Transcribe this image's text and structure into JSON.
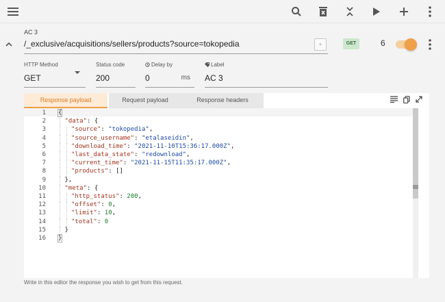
{
  "toolbar": {
    "icons": [
      "menu-icon",
      "search-icon",
      "trash-icon",
      "collapse-all-icon",
      "play-icon",
      "plus-icon",
      "more-vertical-icon"
    ]
  },
  "route": {
    "name": "AC 3",
    "path": "/_exclusive/acquisitions/sellers/products?source=tokopedia",
    "add_label": "+",
    "method_badge": "GET",
    "count": "6",
    "enabled": true
  },
  "fields": {
    "method": {
      "label": "HTTP Method",
      "value": "GET"
    },
    "status": {
      "label": "Status code",
      "value": "200"
    },
    "delay": {
      "label": "Delay by",
      "value": "0",
      "unit": "ms"
    },
    "label": {
      "label": "Label",
      "value": "AC 3"
    }
  },
  "tabs": [
    {
      "label": "Response payload",
      "active": true
    },
    {
      "label": "Request payload",
      "active": false
    },
    {
      "label": "Response headers",
      "active": false
    }
  ],
  "editor": {
    "line_numbers": [
      "1",
      "2",
      "3",
      "4",
      "5",
      "6",
      "7",
      "8",
      "9",
      "10",
      "11",
      "12",
      "13",
      "14",
      "15",
      "16"
    ],
    "lines": [
      [
        {
          "t": "p",
          "v": "{"
        }
      ],
      [
        {
          "t": "k",
          "v": "\"data\""
        },
        {
          "t": "p",
          "v": ": {"
        }
      ],
      [
        {
          "t": "k",
          "v": "\"source\""
        },
        {
          "t": "p",
          "v": ": "
        },
        {
          "t": "s",
          "v": "\"tokopedia\""
        },
        {
          "t": "p",
          "v": ","
        }
      ],
      [
        {
          "t": "k",
          "v": "\"source_username\""
        },
        {
          "t": "p",
          "v": ": "
        },
        {
          "t": "s",
          "v": "\"etalaseidin\""
        },
        {
          "t": "p",
          "v": ","
        }
      ],
      [
        {
          "t": "k",
          "v": "\"download_time\""
        },
        {
          "t": "p",
          "v": ": "
        },
        {
          "t": "s",
          "v": "\"2021-11-10T15:36:17.000Z\""
        },
        {
          "t": "p",
          "v": ","
        }
      ],
      [
        {
          "t": "k",
          "v": "\"last_data_state\""
        },
        {
          "t": "p",
          "v": ": "
        },
        {
          "t": "s",
          "v": "\"redownload\""
        },
        {
          "t": "p",
          "v": ","
        }
      ],
      [
        {
          "t": "k",
          "v": "\"current_time\""
        },
        {
          "t": "p",
          "v": ": "
        },
        {
          "t": "s",
          "v": "\"2021-11-15T11:35:17.000Z\""
        },
        {
          "t": "p",
          "v": ","
        }
      ],
      [
        {
          "t": "k",
          "v": "\"products\""
        },
        {
          "t": "p",
          "v": ": []"
        }
      ],
      [
        {
          "t": "p",
          "v": "},"
        }
      ],
      [
        {
          "t": "k",
          "v": "\"meta\""
        },
        {
          "t": "p",
          "v": ": {"
        }
      ],
      [
        {
          "t": "k",
          "v": "\"http_status\""
        },
        {
          "t": "p",
          "v": ": "
        },
        {
          "t": "n",
          "v": "200"
        },
        {
          "t": "p",
          "v": ","
        }
      ],
      [
        {
          "t": "k",
          "v": "\"offset\""
        },
        {
          "t": "p",
          "v": ": "
        },
        {
          "t": "n",
          "v": "0"
        },
        {
          "t": "p",
          "v": ","
        }
      ],
      [
        {
          "t": "k",
          "v": "\"limit\""
        },
        {
          "t": "p",
          "v": ": "
        },
        {
          "t": "n",
          "v": "10"
        },
        {
          "t": "p",
          "v": ","
        }
      ],
      [
        {
          "t": "k",
          "v": "\"total\""
        },
        {
          "t": "p",
          "v": ": "
        },
        {
          "t": "n",
          "v": "0"
        }
      ],
      [
        {
          "t": "p",
          "v": "}"
        }
      ],
      [
        {
          "t": "p",
          "v": "}"
        }
      ]
    ],
    "indent": [
      0,
      1,
      2,
      2,
      2,
      2,
      2,
      2,
      1,
      1,
      2,
      2,
      2,
      2,
      1,
      0
    ]
  },
  "hint": "Write in this editor the response you wish to get from this request.",
  "colors": {
    "accent": "#f1a04a",
    "get_badge": "#cfe6cf"
  }
}
